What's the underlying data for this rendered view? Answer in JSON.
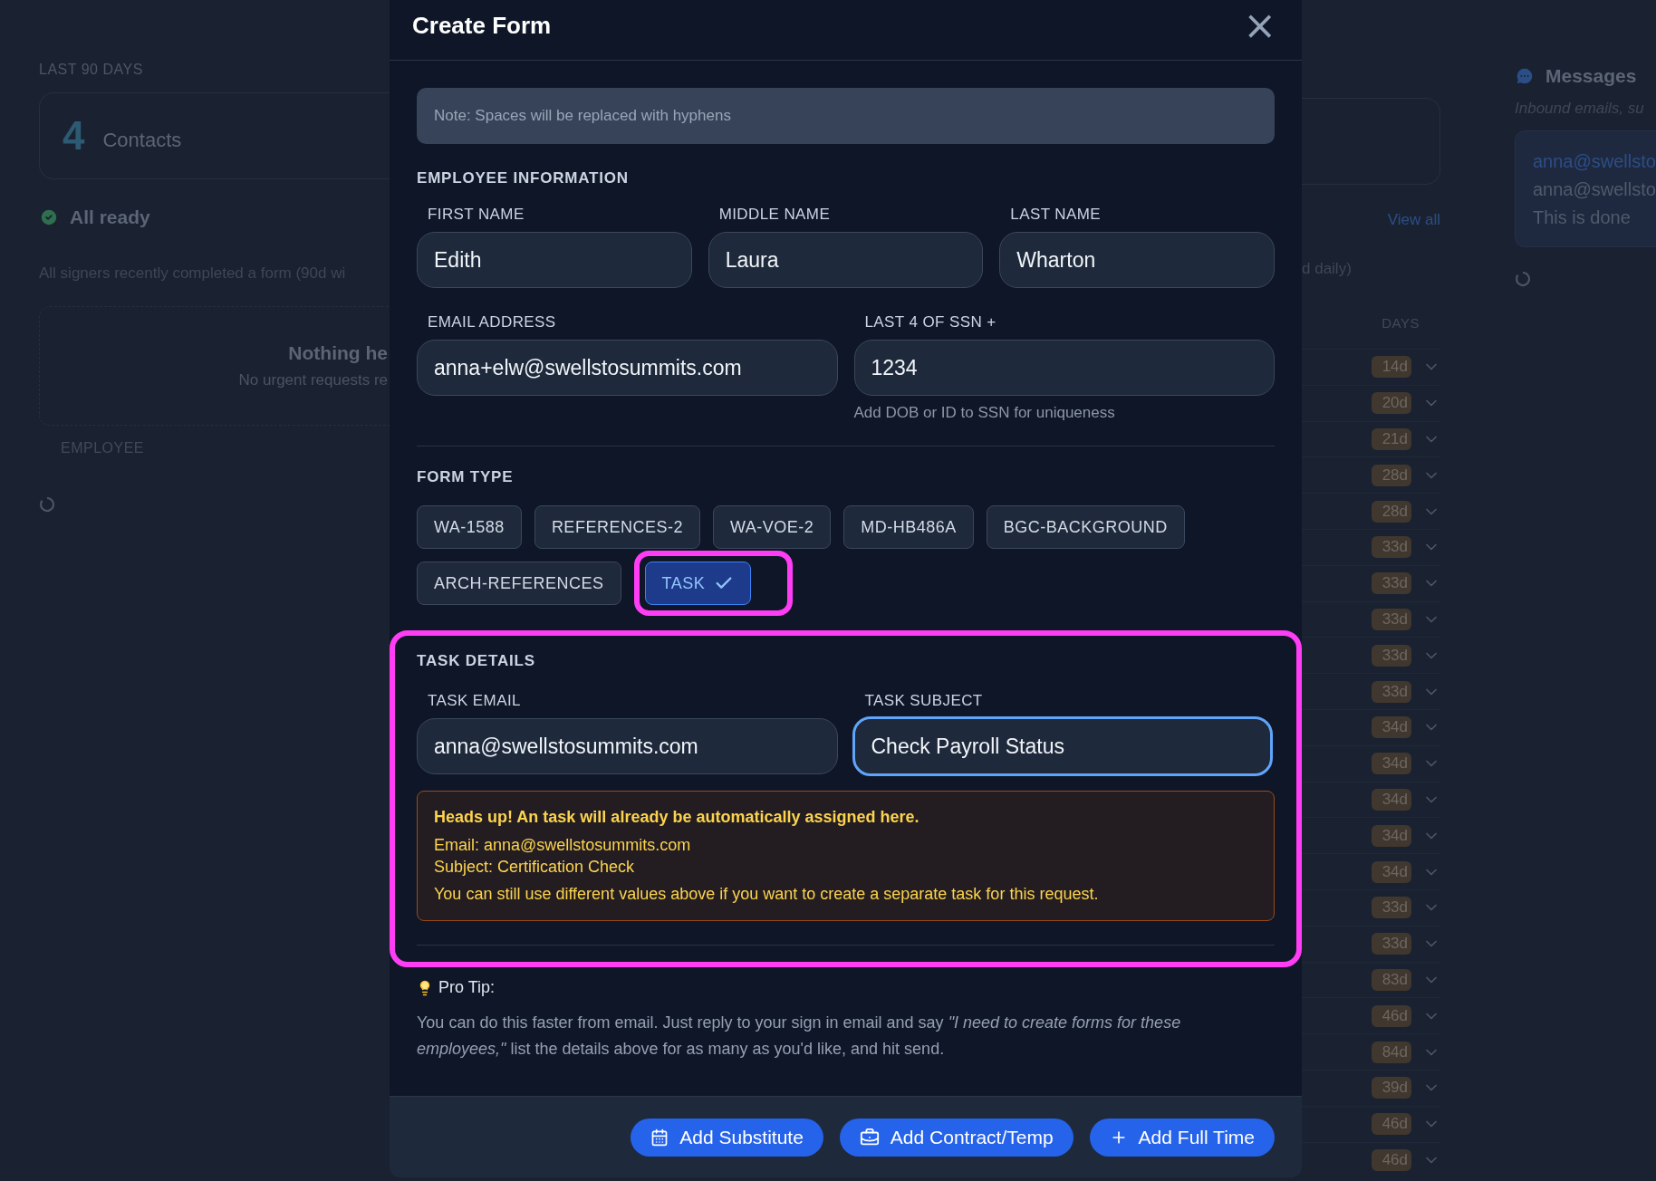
{
  "background": {
    "left": {
      "period_label": "LAST 90 DAYS",
      "stat_value": "4",
      "stat_label": "Contacts",
      "status": "All ready",
      "status_note": "All signers recently completed a form (90d wi",
      "empty_title": "Nothing he",
      "empty_note": "No urgent requests re",
      "column_header": "EMPLOYEE"
    },
    "right": {
      "view_all": "View all",
      "note_tail": "d daily)",
      "column_header": "DAYS",
      "days": [
        "14d",
        "20d",
        "21d",
        "28d",
        "28d",
        "33d",
        "33d",
        "33d",
        "33d",
        "33d",
        "34d",
        "34d",
        "34d",
        "34d",
        "34d",
        "33d",
        "33d",
        "83d",
        "46d",
        "84d",
        "39d",
        "46d",
        "46d"
      ]
    },
    "messages": {
      "title": "Messages",
      "subtitle": "Inbound emails, su",
      "items": [
        {
          "from": "anna@swellsto",
          "to": "anna@swellsto",
          "body": "This is done"
        }
      ]
    }
  },
  "dialog": {
    "title": "Create Form",
    "close": "×",
    "note": "Note: Spaces will be replaced with hyphens",
    "employee_section": "EMPLOYEE INFORMATION",
    "name_fields": [
      {
        "label": "FIRST NAME",
        "value": "Edith"
      },
      {
        "label": "MIDDLE NAME",
        "value": "Laura"
      },
      {
        "label": "LAST NAME",
        "value": "Wharton"
      }
    ],
    "contact_fields": [
      {
        "label": "EMAIL ADDRESS",
        "value": "anna+elw@swellstosummits.com"
      },
      {
        "label": "LAST 4 OF SSN +",
        "value": "1234",
        "hint": "Add DOB or ID to SSN for uniqueness"
      }
    ],
    "form_type_section": "FORM TYPE",
    "form_types": [
      {
        "label": "WA-1588",
        "selected": false,
        "highlighted": false
      },
      {
        "label": "REFERENCES-2",
        "selected": false,
        "highlighted": false
      },
      {
        "label": "WA-VOE-2",
        "selected": false,
        "highlighted": false
      },
      {
        "label": "MD-HB486A",
        "selected": false,
        "highlighted": false
      },
      {
        "label": "BGC-BACKGROUND",
        "selected": false,
        "highlighted": false
      },
      {
        "label": "ARCH-REFERENCES",
        "selected": false,
        "highlighted": false
      },
      {
        "label": "TASK",
        "selected": true,
        "highlighted": true
      }
    ],
    "task_details": {
      "highlighted": true,
      "title": "TASK DETAILS",
      "fields": [
        {
          "label": "TASK EMAIL",
          "value": "anna@swellstosummits.com",
          "focused": false
        },
        {
          "label": "TASK SUBJECT",
          "value": "Check Payroll Status",
          "focused": true
        }
      ],
      "warning": {
        "heading": "Heads up! An task will already be automatically assigned here.",
        "email": "Email: anna@swellstosummits.com",
        "subject": "Subject: Certification Check",
        "note": "You can still use different values above if you want to create a separate task for this request."
      }
    },
    "pro_tip": {
      "title": "Pro Tip:",
      "text": "You can do this faster from email. Just reply to your sign in email and say *\"I need to create forms for these employees,\"* list the details above for as many as you'd like, and hit send."
    },
    "actions": [
      {
        "kind": "calendar",
        "label": "Add Substitute"
      },
      {
        "kind": "briefcase",
        "label": "Add Contract/Temp"
      },
      {
        "kind": "plus",
        "label": "Add Full Time"
      }
    ]
  }
}
